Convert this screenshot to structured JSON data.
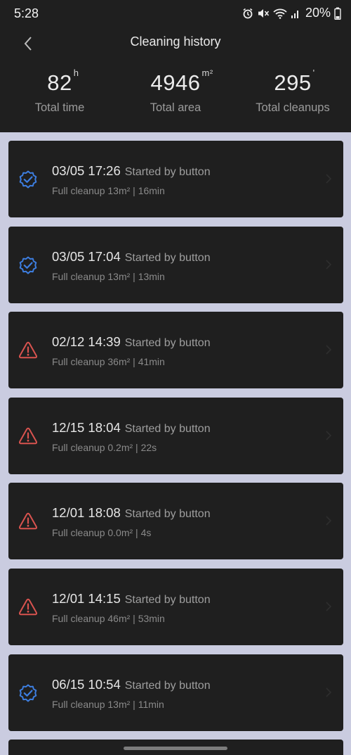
{
  "status_bar": {
    "time": "5:28",
    "battery": "20%",
    "icons": [
      "alarm-icon",
      "mute-icon",
      "wifi-icon",
      "signal-icon",
      "battery-icon"
    ]
  },
  "header": {
    "title": "Cleaning history",
    "back_icon": "chevron-left-icon"
  },
  "stats": [
    {
      "value": "82",
      "unit": "h",
      "label": "Total time"
    },
    {
      "value": "4946",
      "unit": "m²",
      "label": "Total area"
    },
    {
      "value": "295",
      "unit": "'",
      "label": "Total cleanups"
    }
  ],
  "records": [
    {
      "datetime": "03/05 17:26",
      "trigger": "Started by button",
      "summary": "Full cleanup 13m² | 16min",
      "status": "success"
    },
    {
      "datetime": "03/05 17:04",
      "trigger": "Started by button",
      "summary": "Full cleanup 13m² | 13min",
      "status": "success"
    },
    {
      "datetime": "02/12 14:39",
      "trigger": "Started by button",
      "summary": "Full cleanup 36m² | 41min",
      "status": "error"
    },
    {
      "datetime": "12/15 18:04",
      "trigger": "Started by button",
      "summary": "Full cleanup 0.2m² | 22s",
      "status": "error"
    },
    {
      "datetime": "12/01 18:08",
      "trigger": "Started by button",
      "summary": "Full cleanup 0.0m² | 4s",
      "status": "error"
    },
    {
      "datetime": "12/01 14:15",
      "trigger": "Started by button",
      "summary": "Full cleanup 46m² | 53min",
      "status": "error"
    },
    {
      "datetime": "06/15 10:54",
      "trigger": "Started by button",
      "summary": "Full cleanup 13m² | 11min",
      "status": "success"
    }
  ],
  "colors": {
    "success": "#3d7ee0",
    "error": "#d9534f",
    "card_bg": "#1f1f1f",
    "page_bg": "#cacce0"
  }
}
